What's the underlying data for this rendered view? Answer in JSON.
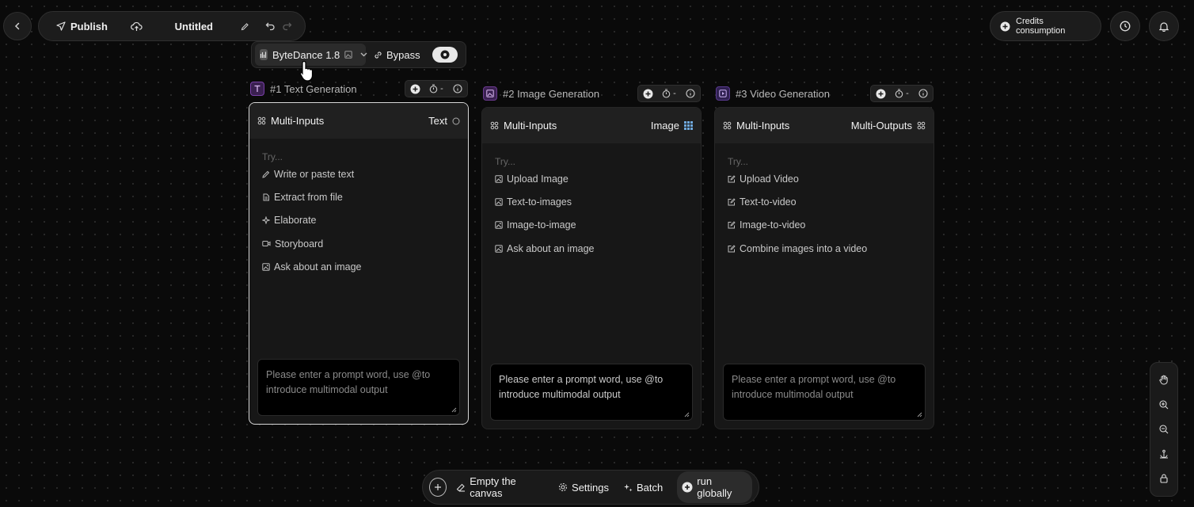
{
  "toolbar": {
    "publish_label": "Publish",
    "title": "Untitled"
  },
  "credits": {
    "label": "Credits consumption"
  },
  "model_bar": {
    "model_name": "ByteDance 1.8",
    "bypass_label": "Bypass"
  },
  "nodes": [
    {
      "title": "#1 Text Generation",
      "ctrl_value": "-",
      "head_left": "Multi-Inputs",
      "head_right": "Text",
      "try_label": "Try...",
      "options": [
        "Write or paste text",
        "Extract from file",
        "Elaborate",
        "Storyboard",
        "Ask about an image"
      ],
      "prompt": "Please enter a prompt word, use @to introduce multimodal output"
    },
    {
      "title": "#2 Image Generation",
      "ctrl_value": "-",
      "head_left": "Multi-Inputs",
      "head_right": "Image",
      "try_label": "Try...",
      "options": [
        "Upload Image",
        "Text-to-images",
        "Image-to-image",
        "Ask about an image"
      ],
      "prompt": "Please enter a prompt word, use @to introduce multimodal output"
    },
    {
      "title": "#3 Video Generation",
      "ctrl_value": "-",
      "head_left": "Multi-Inputs",
      "head_right": "Multi-Outputs",
      "try_label": "Try...",
      "options": [
        "Upload Video",
        "Text-to-video",
        "Image-to-video",
        "Combine images into a video"
      ],
      "prompt": "Please enter a prompt word, use @to introduce multimodal output"
    }
  ],
  "bottom_bar": {
    "empty_label": "Empty the canvas",
    "settings_label": "Settings",
    "batch_label": "Batch",
    "run_label": "run globally"
  },
  "colors": {
    "background": "#0a0a0a",
    "text_badge": "#7a3fa8",
    "image_badge": "#6b3a8f",
    "video_badge": "#5a3a90",
    "image_grid_icon": "#6fa8dc"
  }
}
